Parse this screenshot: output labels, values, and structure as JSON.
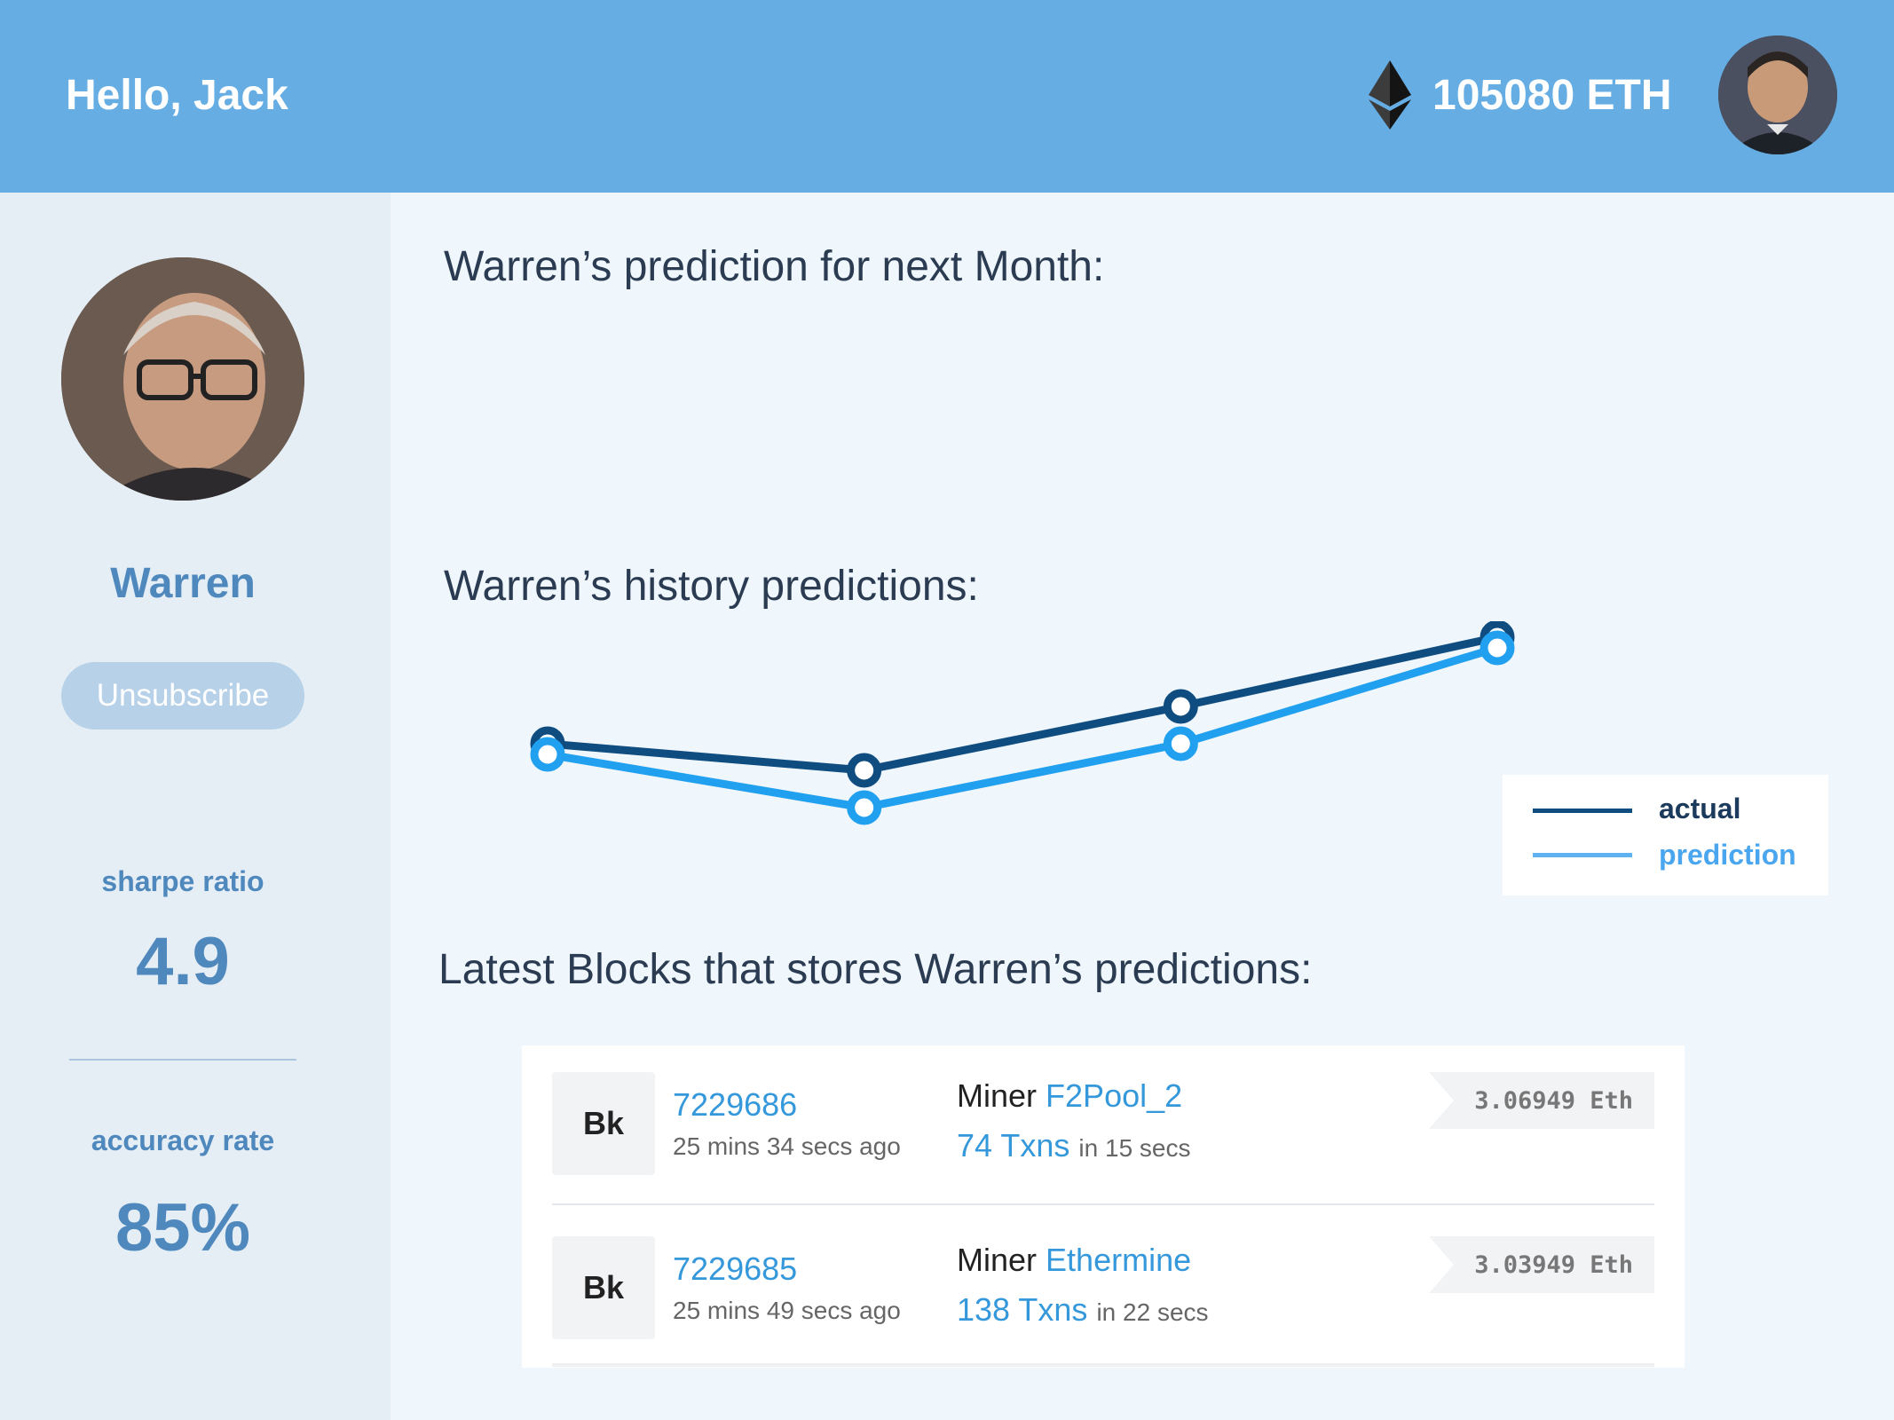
{
  "header": {
    "greeting": "Hello, Jack",
    "balance": "105080 ETH",
    "eth_icon": "ethereum-icon",
    "avatar": "user-avatar"
  },
  "profile": {
    "name": "Warren",
    "unsubscribe_label": "Unsubscribe",
    "stats": [
      {
        "label": "sharpe ratio",
        "value": "4.9"
      },
      {
        "label": "accuracy rate",
        "value": "85%"
      }
    ]
  },
  "sections": {
    "next_month": "Warren’s prediction for next Month:",
    "history": "Warren’s history predictions:",
    "blocks": "Latest Blocks that stores Warren’s predictions:"
  },
  "chart_data": {
    "type": "line",
    "title": "",
    "x": [
      1,
      2,
      3,
      4
    ],
    "series": [
      {
        "name": "actual",
        "values": [
          77,
          72,
          84,
          97
        ],
        "color": "#0f4c7f"
      },
      {
        "name": "prediction",
        "values": [
          75,
          65,
          77,
          95
        ],
        "color": "#21a0f0"
      }
    ],
    "ylim": [
      50,
      100
    ],
    "grid": false,
    "legend": "right"
  },
  "blocks": [
    {
      "badge": "Bk",
      "number": "7229686",
      "age": "25 mins 34 secs ago",
      "miner_label": "Miner",
      "miner": "F2Pool_2",
      "txns": "74 Txns",
      "duration": "in 15 secs",
      "reward": "3.06949 Eth"
    },
    {
      "badge": "Bk",
      "number": "7229685",
      "age": "25 mins 49 secs ago",
      "miner_label": "Miner",
      "miner": "Ethermine",
      "txns": "138 Txns",
      "duration": "in 22 secs",
      "reward": "3.03949 Eth"
    }
  ]
}
